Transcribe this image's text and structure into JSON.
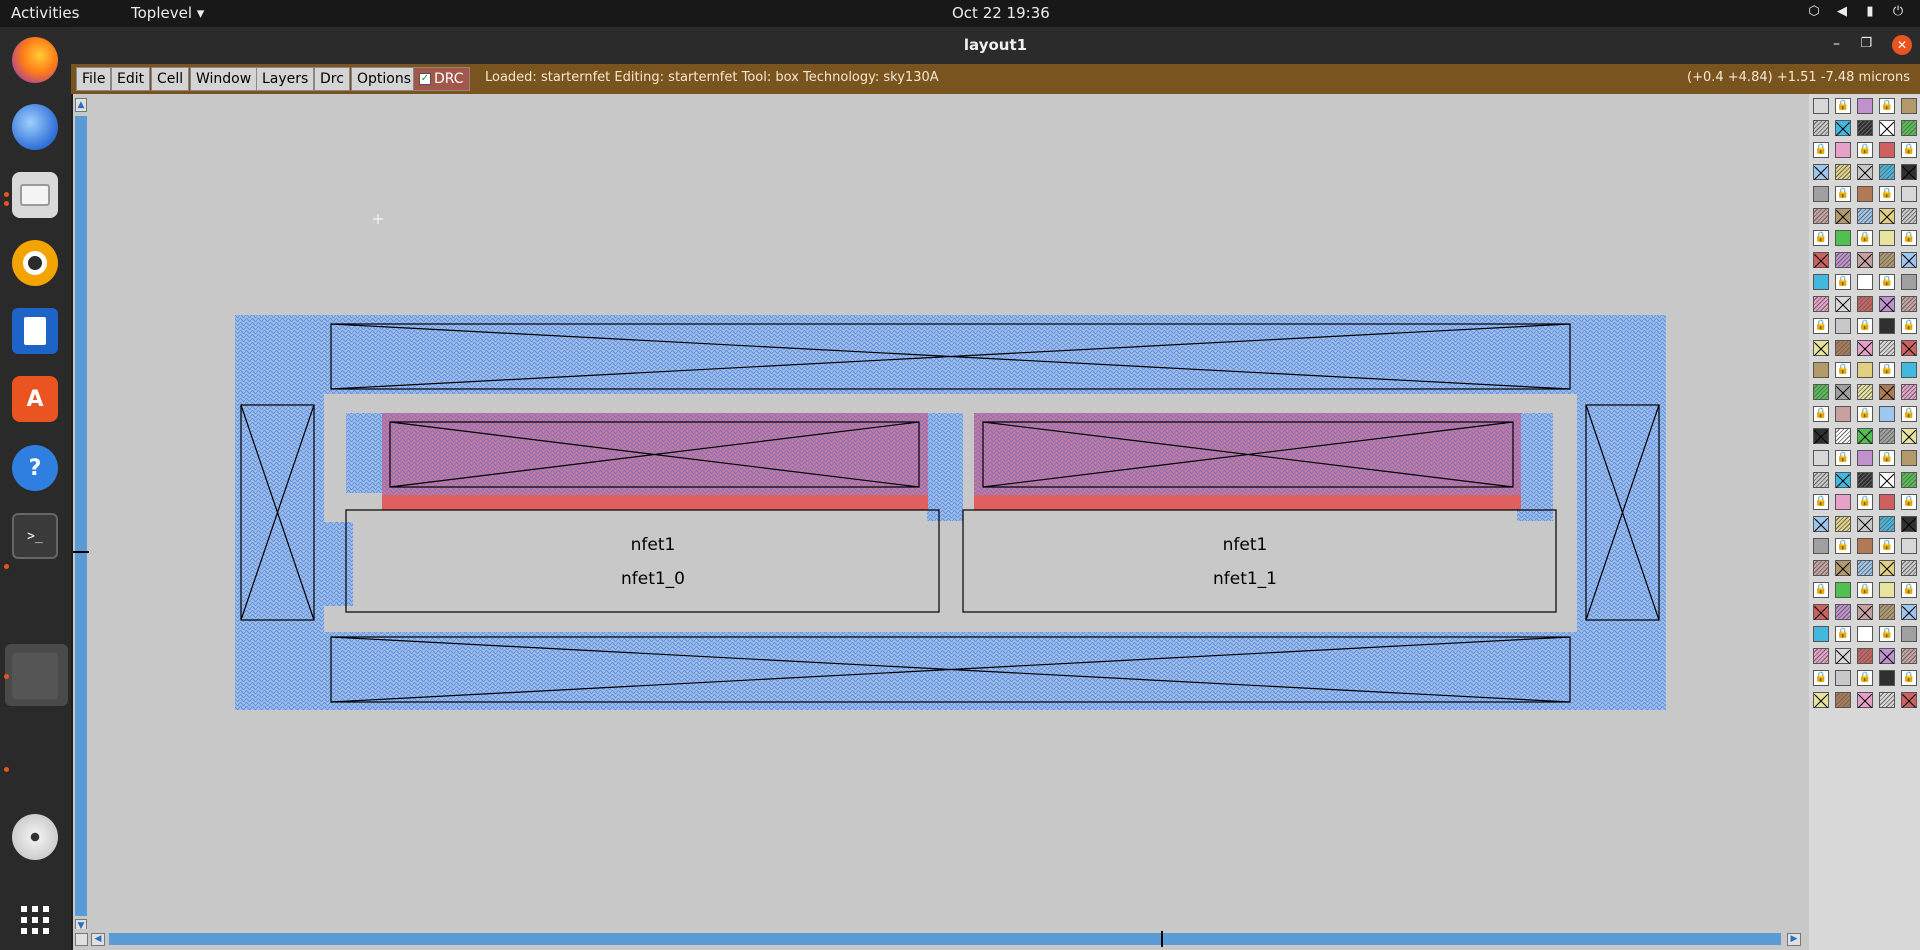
{
  "topbar": {
    "activities": "Activities",
    "app_menu": "Toplevel ▾",
    "clock": "Oct 22  19:36"
  },
  "dock": {
    "items": [
      {
        "name": "firefox",
        "icon": "firefox-icon"
      },
      {
        "name": "thunderbird",
        "icon": "mail-icon"
      },
      {
        "name": "files",
        "icon": "folder-icon"
      },
      {
        "name": "rhythmbox",
        "icon": "music-icon"
      },
      {
        "name": "writer",
        "icon": "document-icon"
      },
      {
        "name": "software",
        "icon": "store-icon"
      },
      {
        "name": "help",
        "icon": "help-icon"
      },
      {
        "name": "terminal",
        "icon": "terminal-icon"
      },
      {
        "name": "magic",
        "icon": "app-window-icon"
      },
      {
        "name": "disc",
        "icon": "disc-icon"
      },
      {
        "name": "show-apps",
        "icon": "grid-icon"
      }
    ],
    "help_glyph": "?",
    "terminal_glyph": ">_"
  },
  "window": {
    "title": "layout1",
    "minimize": "–",
    "maximize": "❐",
    "close": "✕"
  },
  "menubar": {
    "file": "File",
    "edit": "Edit",
    "cell": "Cell",
    "window": "Window",
    "layers": "Layers",
    "drc": "Drc",
    "options": "Options",
    "drc_toggle": "DRC",
    "drc_check": "✓",
    "status": "Loaded: starternfet Editing: starternfet Tool: box  Technology: sky130A",
    "coords": "(+0.4 +4.84) +1.51 -7.48 microns"
  },
  "layout": {
    "cells": [
      {
        "type": "nfet1",
        "instance": "nfet1_0"
      },
      {
        "type": "nfet1",
        "instance": "nfet1_1"
      }
    ]
  },
  "colors": {
    "accent": "#e95420",
    "menubar": "#7a541f",
    "canvas": "#c8c8c8",
    "diffusion_blue": "#8fb4ea",
    "poly_red": "#e06060",
    "scroll_blue": "#5b9bd5"
  }
}
